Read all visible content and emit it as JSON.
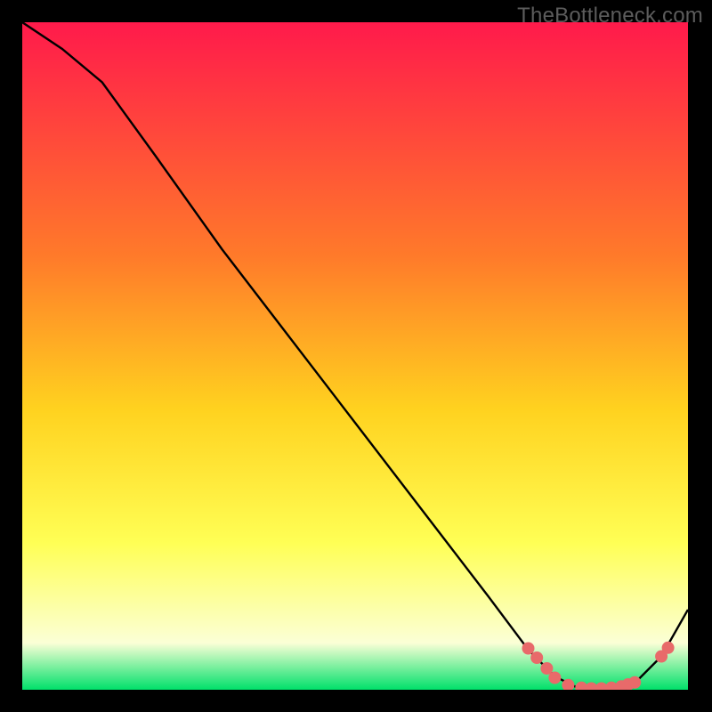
{
  "watermark": "TheBottleneck.com",
  "colors": {
    "background": "#000000",
    "grad_top": "#ff1a4b",
    "grad_mid1": "#ff7a2a",
    "grad_mid2": "#ffd21f",
    "grad_mid3": "#ffff55",
    "grad_mid4": "#fbffd6",
    "grad_bottom": "#00e06a",
    "curve": "#000000",
    "dot_fill": "#e86a6a",
    "dot_stroke": "#e86a6a"
  },
  "chart_data": {
    "type": "line",
    "title": "",
    "xlabel": "",
    "ylabel": "",
    "xlim": [
      0,
      100
    ],
    "ylim": [
      0,
      100
    ],
    "series": [
      {
        "name": "curve",
        "x": [
          0,
          6,
          12,
          20,
          30,
          40,
          50,
          60,
          70,
          76,
          80,
          84,
          88,
          92,
          96,
          100
        ],
        "y": [
          100,
          96,
          91,
          80,
          66,
          53,
          40,
          27,
          14,
          6,
          2,
          0,
          0,
          1,
          5,
          12
        ]
      }
    ],
    "dots": [
      {
        "x": 76.0,
        "y": 6.2
      },
      {
        "x": 77.3,
        "y": 4.8
      },
      {
        "x": 78.8,
        "y": 3.2
      },
      {
        "x": 80.0,
        "y": 1.8
      },
      {
        "x": 82.0,
        "y": 0.7
      },
      {
        "x": 84.0,
        "y": 0.3
      },
      {
        "x": 85.5,
        "y": 0.2
      },
      {
        "x": 87.0,
        "y": 0.2
      },
      {
        "x": 88.5,
        "y": 0.3
      },
      {
        "x": 90.0,
        "y": 0.5
      },
      {
        "x": 91.0,
        "y": 0.8
      },
      {
        "x": 92.0,
        "y": 1.1
      },
      {
        "x": 96.0,
        "y": 5.0
      },
      {
        "x": 97.0,
        "y": 6.3
      }
    ]
  }
}
